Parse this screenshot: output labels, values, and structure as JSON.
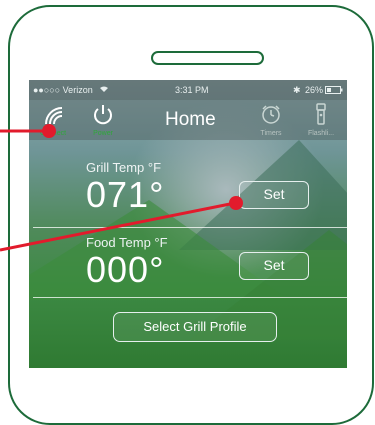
{
  "status": {
    "carrier": "●●○○○ Verizon",
    "time": "3:31 PM",
    "battery": "26%"
  },
  "nav": {
    "title": "Home",
    "connect_label": "Connect",
    "power_label": "Power",
    "timers_label": "Timers",
    "flashlight_label": "Flashli..."
  },
  "grill": {
    "label": "Grill Temp °F",
    "value": "071°",
    "set_label": "Set"
  },
  "food": {
    "label": "Food Temp °F",
    "value": "000°",
    "set_label": "Set"
  },
  "profile_button": "Select Grill Profile",
  "colors": {
    "frame": "#1d6b3a",
    "annotation": "#e21b2c",
    "active_icon": "#2fa83a"
  }
}
